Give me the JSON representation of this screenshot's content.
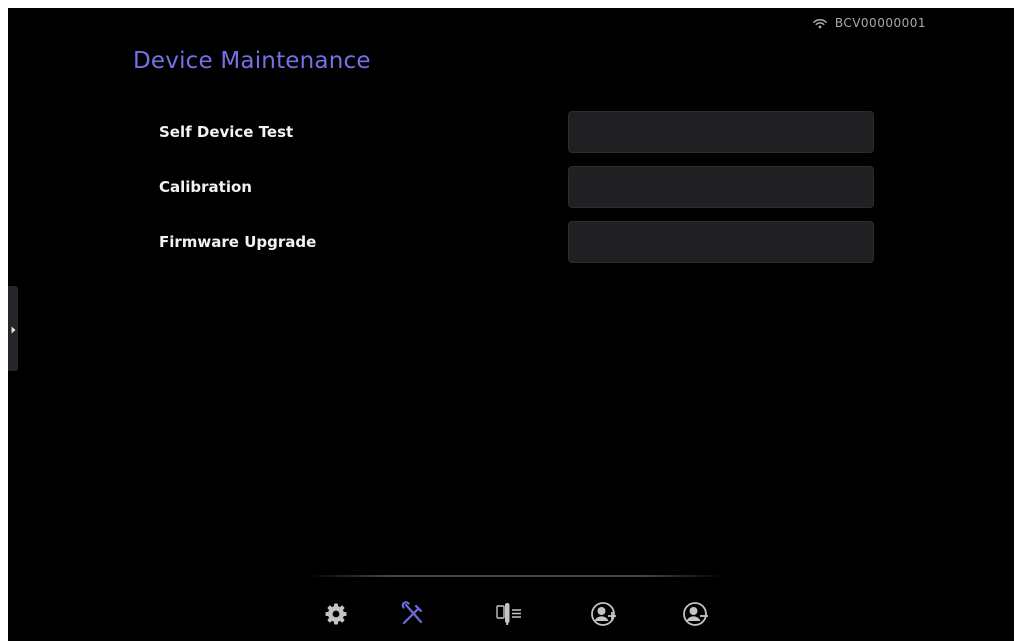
{
  "status_bar": {
    "device_id": "BCV00000001",
    "wifi_icon": "wifi-icon"
  },
  "page": {
    "title": "Device Maintenance"
  },
  "rows": [
    {
      "label": "Self Device Test",
      "control_value": ""
    },
    {
      "label": "Calibration",
      "control_value": ""
    },
    {
      "label": "Firmware Upgrade",
      "control_value": ""
    }
  ],
  "side_panel": {
    "toggle_icon": "caret-right-icon"
  },
  "bottom_nav": {
    "items": [
      {
        "icon": "gear-icon",
        "active": false
      },
      {
        "icon": "tools-icon",
        "active": true
      },
      {
        "icon": "device-list-icon",
        "active": false
      },
      {
        "icon": "add-user-icon",
        "active": false
      },
      {
        "icon": "remove-user-icon",
        "active": false
      }
    ]
  },
  "colors": {
    "background": "#000000",
    "title": "#7570e6",
    "accent_active": "#6f6bd9",
    "icon_inactive": "#c4c4c8",
    "control_fill": "#202022",
    "label_text": "#f2f2f2",
    "status_text": "#a9a9b2"
  }
}
